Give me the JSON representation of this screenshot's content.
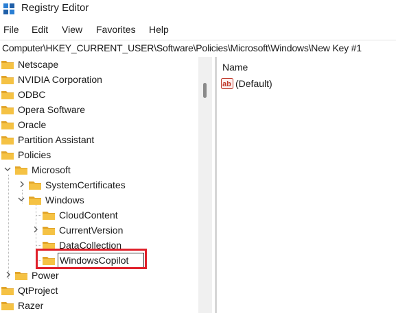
{
  "window": {
    "title": "Registry Editor"
  },
  "menu": [
    "File",
    "Edit",
    "View",
    "Favorites",
    "Help"
  ],
  "address": "Computer\\HKEY_CURRENT_USER\\Software\\Policies\\Microsoft\\Windows\\New Key #1",
  "tree": {
    "items": [
      {
        "label": "Netscape",
        "expander": ""
      },
      {
        "label": "NVIDIA Corporation",
        "expander": ""
      },
      {
        "label": "ODBC",
        "expander": ""
      },
      {
        "label": "Opera Software",
        "expander": ""
      },
      {
        "label": "Oracle",
        "expander": ""
      },
      {
        "label": "Partition Assistant",
        "expander": ""
      },
      {
        "label": "Policies",
        "expander": ""
      },
      {
        "label": "Microsoft",
        "expander": "expanded"
      },
      {
        "label": "SystemCertificates",
        "expander": "collapsed"
      },
      {
        "label": "Windows",
        "expander": "expanded"
      },
      {
        "label": "CloudContent",
        "expander": ""
      },
      {
        "label": "CurrentVersion",
        "expander": "collapsed"
      },
      {
        "label": "DataCollection",
        "expander": ""
      },
      {
        "label": "WindowsCopilot",
        "expander": "",
        "editing": true
      },
      {
        "label": "Power",
        "expander": "collapsed"
      },
      {
        "label": "QtProject",
        "expander": ""
      },
      {
        "label": "Razer",
        "expander": ""
      }
    ]
  },
  "list": {
    "column_name": "Name",
    "values": [
      {
        "name": "(Default)",
        "icon": "string-value-icon"
      }
    ]
  },
  "colors": {
    "folder": "#f5c244",
    "folder_dark": "#e2a52a",
    "highlight": "#e0202a"
  }
}
